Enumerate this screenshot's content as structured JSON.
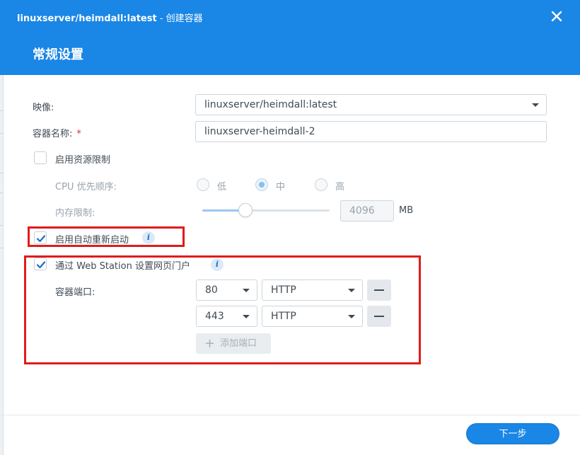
{
  "window": {
    "title_main": "linuxserver/heimdall:latest",
    "title_suffix": " - 创建容器",
    "close_icon": "close-icon"
  },
  "section": {
    "title": "常规设置"
  },
  "form": {
    "image": {
      "label": "映像:",
      "value": "linuxserver/heimdall:latest"
    },
    "container_name": {
      "label": "容器名称:",
      "required": "*",
      "value": "linuxserver-heimdall-2"
    },
    "resource_limit": {
      "label": "启用资源限制",
      "checked": false
    },
    "cpu_priority": {
      "label": "CPU 优先顺序:",
      "options": [
        "低",
        "中",
        "高"
      ],
      "selected": "中"
    },
    "memory_limit": {
      "label": "内存限制:",
      "value": "4096",
      "unit": "MB",
      "slider_fraction": 0.34
    },
    "auto_restart": {
      "label": "启用自动重新启动",
      "checked": true
    },
    "web_station": {
      "label": "通过 Web Station 设置网页门户",
      "checked": true
    },
    "container_ports": {
      "label": "容器端口:",
      "rows": [
        {
          "port": "80",
          "protocol": "HTTP"
        },
        {
          "port": "443",
          "protocol": "HTTP"
        }
      ],
      "add_label": "添加端口"
    }
  },
  "footer": {
    "next_label": "下一步"
  },
  "colors": {
    "accent": "#1a86e6",
    "annotation": "#e11b1b"
  }
}
